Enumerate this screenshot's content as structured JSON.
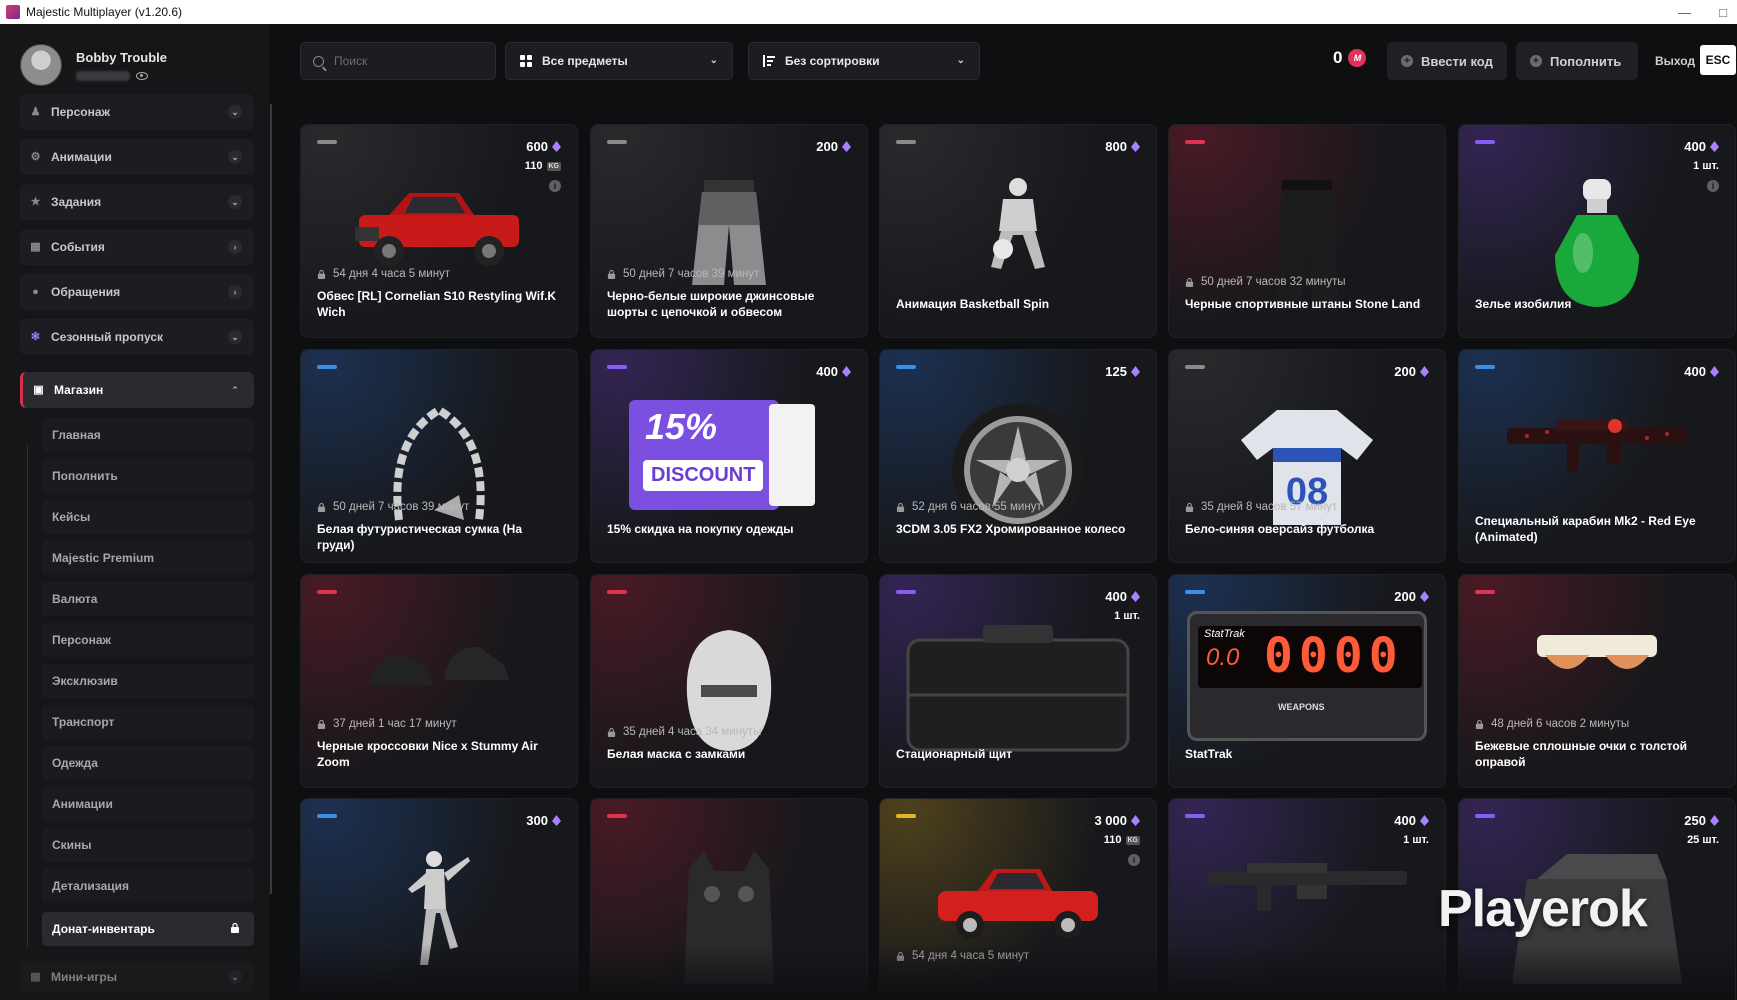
{
  "window": {
    "title": "Majestic Multiplayer (v1.20.6)"
  },
  "profile": {
    "name": "Bobby Trouble"
  },
  "sidebar": {
    "items": [
      {
        "label": "Персонаж",
        "icon": "person-icon"
      },
      {
        "label": "Анимации",
        "icon": "gear-icon"
      },
      {
        "label": "Задания",
        "icon": "star-icon"
      },
      {
        "label": "События",
        "icon": "calendar-icon"
      },
      {
        "label": "Обращения",
        "icon": "chat-icon"
      },
      {
        "label": "Сезонный пропуск",
        "icon": "sparkle-icon"
      },
      {
        "label": "Магазин",
        "icon": "bag-icon"
      }
    ],
    "shop_sub": [
      "Главная",
      "Пополнить",
      "Кейсы",
      "Majestic Premium",
      "Валюта",
      "Персонаж",
      "Эксклюзив",
      "Транспорт",
      "Одежда",
      "Анимации",
      "Скины",
      "Детализация",
      "Донат-инвентарь"
    ],
    "extra": "Мини-игры"
  },
  "toolbar": {
    "search_placeholder": "Поиск",
    "filter_value": "Все предметы",
    "sort_value": "Без сортировки",
    "balance": "0",
    "code_label": "Ввести код",
    "topup_label": "Пополнить",
    "exit_label": "Выход",
    "esc_label": "ESC"
  },
  "colors": {
    "accent": "#d6324f",
    "gem": "#a980ff",
    "rarity_gray": "#8a8a8a",
    "rarity_red": "#e0334f",
    "rarity_purple": "#8a5cf6",
    "rarity_blue": "#3b8fe8",
    "rarity_gold": "#e6b522"
  },
  "cards": [
    {
      "price": "600",
      "sub": "110",
      "sub_unit": "KG",
      "timer": "54 дня 4 часа 5 минут",
      "title": "Обвес [RL] Cornelian S10 Restyling Wif.K Wich",
      "rarity": "gray",
      "art": "red-pickup-truck"
    },
    {
      "price": "200",
      "sub": "",
      "timer": "50 дней 7 часов 39 минут",
      "title": "Черно-белые широкие джинсовые шорты с цепочкой и обвесом",
      "rarity": "gray",
      "art": "denim-shorts"
    },
    {
      "price": "800",
      "sub": "",
      "timer": "",
      "title": "Анимация Basketball Spin",
      "rarity": "gray",
      "art": "basketball-figure"
    },
    {
      "price": "",
      "sub": "",
      "timer": "50 дней 7 часов 32 минуты",
      "title": "Черные спортивные штаны Stone Land",
      "rarity": "red",
      "art": "black-pants"
    },
    {
      "price": "400",
      "sub": "1 шт.",
      "timer": "",
      "title": "Зелье изобилия",
      "rarity": "purple",
      "art": "green-potion"
    },
    {
      "price": "",
      "sub": "",
      "timer": "50 дней 7 часов 39 минут",
      "title": "Белая футуристическая сумка (На груди)",
      "rarity": "blue",
      "art": "chain-bag"
    },
    {
      "price": "400",
      "sub": "",
      "timer": "",
      "title": "15% скидка на покупку одежды",
      "rarity": "purple",
      "art": "discount-ticket",
      "badge_pct": "15%",
      "badge_text": "DISCOUNT"
    },
    {
      "price": "125",
      "sub": "",
      "timer": "52 дня 6 часов 55 минут",
      "title": "3CDM 3.05 FX2 Хромированное колесо",
      "rarity": "blue",
      "art": "chrome-wheel"
    },
    {
      "price": "200",
      "sub": "",
      "timer": "35 дней 8 часов 57 минут",
      "title": "Бело-синяя оверсайз футболка",
      "rarity": "gray",
      "art": "jersey"
    },
    {
      "price": "400",
      "sub": "",
      "timer": "",
      "title": "Специальный карабин Mk2 - Red Eye (Animated)",
      "rarity": "blue",
      "art": "carbine-rifle"
    },
    {
      "price": "",
      "sub": "",
      "timer": "37 дней 1 час 17 минут",
      "title": "Черные кроссовки Nice x Stummy Air Zoom",
      "rarity": "red",
      "art": "black-sneakers"
    },
    {
      "price": "",
      "sub": "",
      "timer": "35 дней 4 часа 34 минуты",
      "title": "Белая маска с замками",
      "rarity": "red",
      "art": "white-mask"
    },
    {
      "price": "400",
      "sub": "1 шт.",
      "timer": "",
      "title": "Стационарный щит",
      "rarity": "purple",
      "art": "shield-case"
    },
    {
      "price": "200",
      "sub": "",
      "timer": "",
      "title": "StatTrak",
      "rarity": "blue",
      "art": "stattrak-counter",
      "stat_label": "StatTrak",
      "stat_digits": "0000",
      "stat_small": "0.0",
      "stat_weapons": "WEAPONS"
    },
    {
      "price": "",
      "sub": "",
      "timer": "48 дней 6 часов 2 минуты",
      "title": "Бежевые сплошные очки с толстой оправой",
      "rarity": "red",
      "art": "beige-glasses"
    },
    {
      "price": "300",
      "sub": "",
      "timer": "",
      "title": "",
      "rarity": "blue",
      "art": "dance-figure"
    },
    {
      "price": "",
      "sub": "",
      "timer": "",
      "title": "",
      "rarity": "red",
      "art": "cat-backpack"
    },
    {
      "price": "3 000",
      "sub": "110",
      "sub_unit": "KG",
      "timer": "54 дня 4 часа 5 минут",
      "title": "",
      "rarity": "gold",
      "art": "red-truck-2"
    },
    {
      "price": "400",
      "sub": "1 шт.",
      "timer": "",
      "title": "",
      "rarity": "purple",
      "art": "machine-gun"
    },
    {
      "price": "250",
      "sub": "25 шт.",
      "timer": "",
      "title": "",
      "rarity": "purple",
      "art": "metal-case"
    }
  ],
  "watermark": "Playerok"
}
